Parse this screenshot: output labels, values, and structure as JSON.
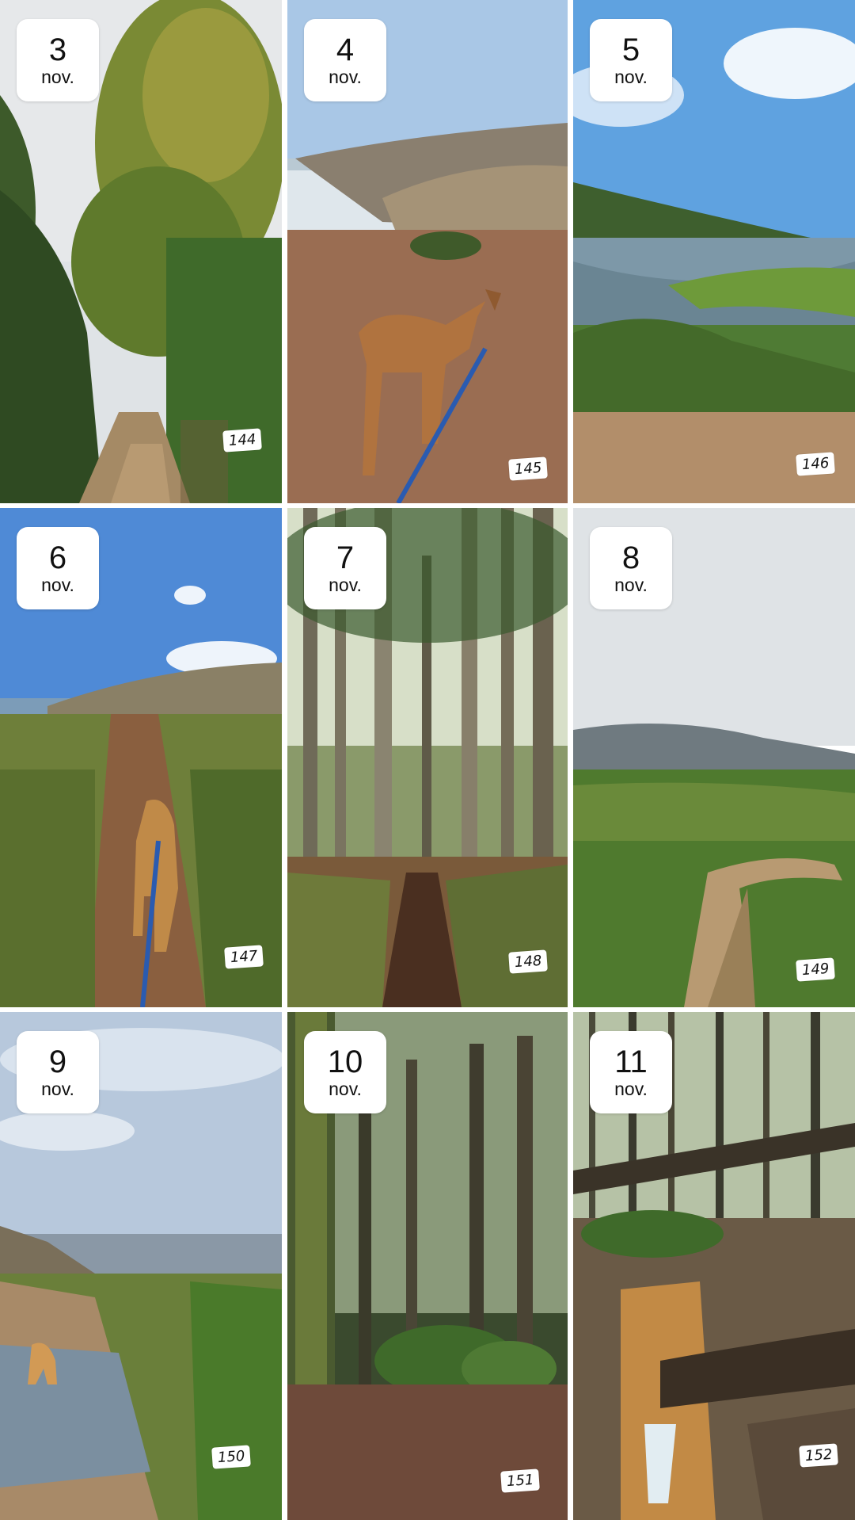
{
  "gallery": {
    "tiles": [
      {
        "day": "3",
        "month": "nov.",
        "number": "144",
        "scene": "path-tree-icon"
      },
      {
        "day": "4",
        "month": "nov.",
        "number": "145",
        "scene": "dog-coast-icon"
      },
      {
        "day": "5",
        "month": "nov.",
        "number": "146",
        "scene": "river-valley-icon"
      },
      {
        "day": "6",
        "month": "nov.",
        "number": "147",
        "scene": "dog-trail-coast-icon"
      },
      {
        "day": "7",
        "month": "nov.",
        "number": "148",
        "scene": "forest-path-icon"
      },
      {
        "day": "8",
        "month": "nov.",
        "number": "149",
        "scene": "hill-path-icon"
      },
      {
        "day": "9",
        "month": "nov.",
        "number": "150",
        "scene": "dog-puddle-icon"
      },
      {
        "day": "10",
        "month": "nov.",
        "number": "151",
        "scene": "mossy-forest-icon"
      },
      {
        "day": "11",
        "month": "nov.",
        "number": "152",
        "scene": "stream-forest-icon"
      }
    ]
  }
}
